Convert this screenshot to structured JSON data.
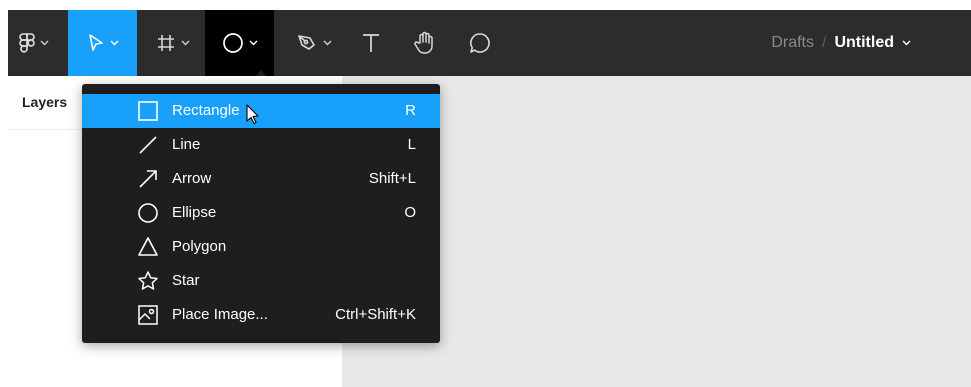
{
  "toolbar": {
    "tools": [
      {
        "name": "main-menu",
        "icon": "figma-logo-icon"
      },
      {
        "name": "move",
        "icon": "cursor-arrow-icon",
        "active": true
      },
      {
        "name": "frame",
        "icon": "hash-icon"
      },
      {
        "name": "shape",
        "icon": "circle-icon",
        "open": true
      },
      {
        "name": "pen",
        "icon": "pen-icon"
      },
      {
        "name": "text",
        "icon": "text-icon"
      },
      {
        "name": "hand",
        "icon": "hand-icon"
      },
      {
        "name": "comment",
        "icon": "comment-icon"
      }
    ],
    "doc_folder": "Drafts",
    "doc_separator": "/",
    "doc_name": "Untitled"
  },
  "left_panel": {
    "tab_label": "Layers"
  },
  "shape_menu": {
    "items": [
      {
        "label": "Rectangle",
        "shortcut": "R",
        "icon": "rectangle-icon",
        "highlighted": true
      },
      {
        "label": "Line",
        "shortcut": "L",
        "icon": "line-icon"
      },
      {
        "label": "Arrow",
        "shortcut": "Shift+L",
        "icon": "arrow-icon"
      },
      {
        "label": "Ellipse",
        "shortcut": "O",
        "icon": "ellipse-icon"
      },
      {
        "label": "Polygon",
        "shortcut": "",
        "icon": "polygon-icon"
      },
      {
        "label": "Star",
        "shortcut": "",
        "icon": "star-icon"
      },
      {
        "label": "Place Image...",
        "shortcut": "Ctrl+Shift+K",
        "icon": "image-icon"
      }
    ]
  },
  "colors": {
    "toolbar_bg": "#2c2c2c",
    "accent": "#18a0fb",
    "menu_bg": "#1e1e1e",
    "canvas_bg": "#e8e8e8"
  }
}
